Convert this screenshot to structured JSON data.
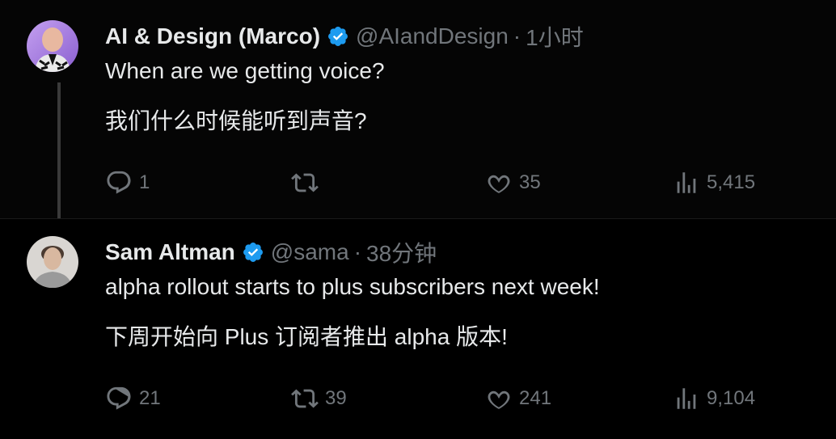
{
  "tweets": [
    {
      "name": "AI & Design (Marco)",
      "handle": "@AIandDesign",
      "separator": "·",
      "time": "1小时",
      "text_en": "When are we getting voice?",
      "text_zh": "我们什么时候能听到声音?",
      "replies": "1",
      "retweets": "",
      "likes": "35",
      "views": "5,415"
    },
    {
      "name": "Sam Altman",
      "handle": "@sama",
      "separator": "·",
      "time": "38分钟",
      "text_en": "alpha rollout starts to plus subscribers next week!",
      "text_zh": "下周开始向 Plus 订阅者推出 alpha 版本!",
      "replies": "21",
      "retweets": "39",
      "likes": "241",
      "views": "9,104"
    }
  ],
  "colors": {
    "verified": "#1d9bf0",
    "muted": "#71767b",
    "text": "#e7e9ea"
  },
  "icons": [
    "reply-icon",
    "retweet-icon",
    "like-icon",
    "views-icon",
    "verified-badge-icon"
  ]
}
